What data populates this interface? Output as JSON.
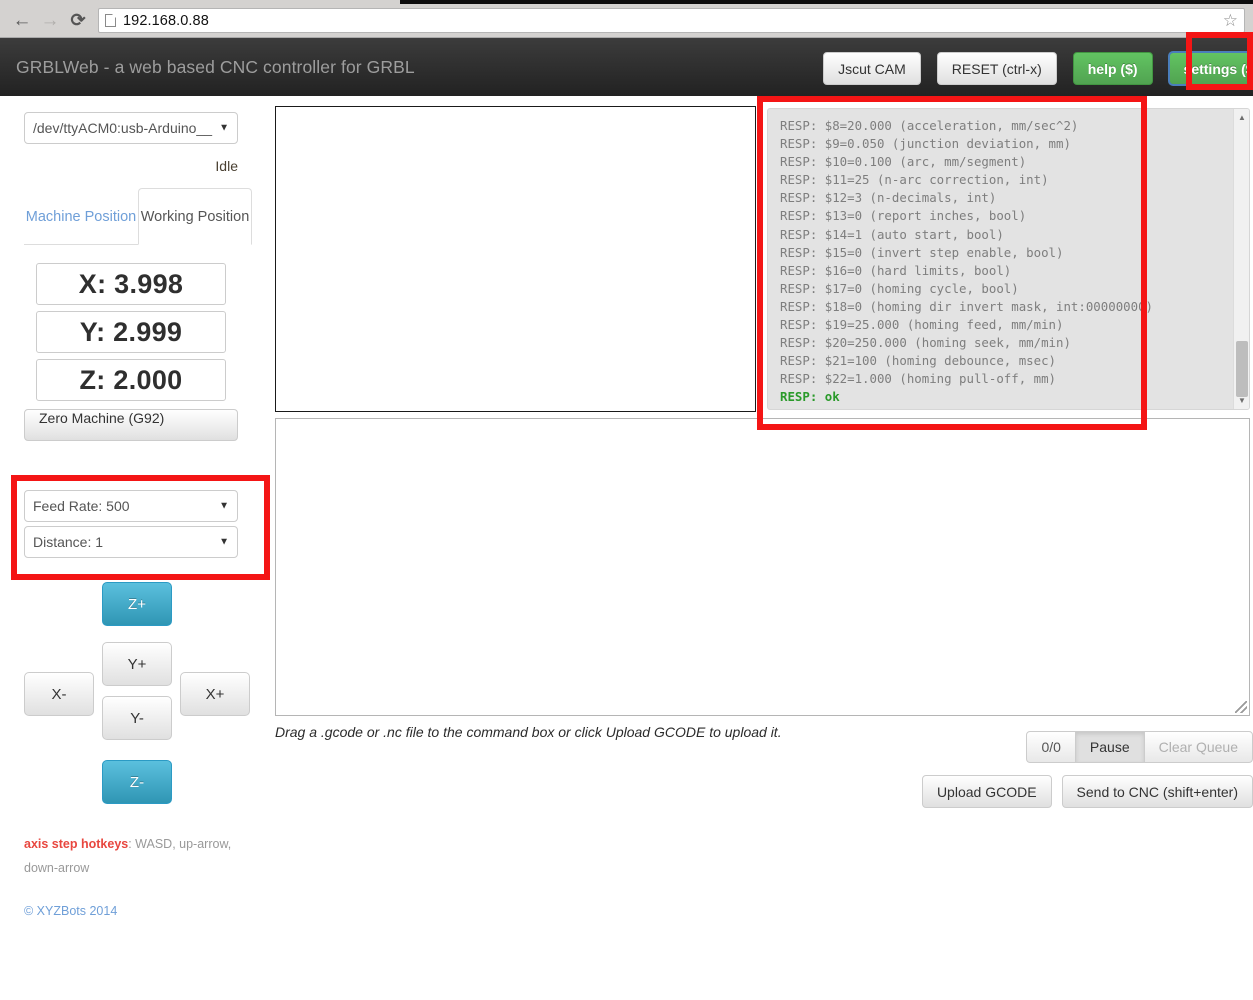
{
  "browser": {
    "url": "192.168.0.88",
    "back_icon": "back-arrow-icon",
    "forward_icon": "forward-arrow-icon",
    "reload_icon": "reload-icon",
    "page_icon": "page-icon",
    "star_icon": "star-icon"
  },
  "navbar": {
    "brand": "GRBLWeb - a web based CNC controller for GRBL",
    "buttons": [
      {
        "label": "Jscut CAM",
        "style": "default"
      },
      {
        "label": "RESET (ctrl-x)",
        "style": "default"
      },
      {
        "label": "help ($)",
        "style": "success"
      },
      {
        "label": "settings ($$)",
        "style": "success"
      }
    ]
  },
  "sidebar": {
    "port_select": "/dev/ttyACM0:usb-Arduino__",
    "status": "Idle",
    "tabs": [
      {
        "label": "Machine Position",
        "active": false
      },
      {
        "label": "Working Position",
        "active": true
      }
    ],
    "coords": [
      {
        "axis": "X",
        "text": "X: 3.998"
      },
      {
        "axis": "Y",
        "text": "Y: 2.999"
      },
      {
        "axis": "Z",
        "text": "Z: 2.000"
      }
    ],
    "zero_button": "Zero Machine (G92)",
    "feed_rate": "Feed Rate: 500",
    "distance": "Distance: 1",
    "jog": {
      "z_plus": "Z+",
      "y_plus": "Y+",
      "x_minus": "X-",
      "x_plus": "X+",
      "y_minus": "Y-",
      "z_minus": "Z-"
    },
    "hotkeys_label": "axis step hotkeys",
    "hotkeys_value": ": WASD, up-arrow, down-arrow",
    "copyright": "© XYZBots 2014"
  },
  "console": {
    "lines": "RESP: $8=20.000 (acceleration, mm/sec^2)\nRESP: $9=0.050 (junction deviation, mm)\nRESP: $10=0.100 (arc, mm/segment)\nRESP: $11=25 (n-arc correction, int)\nRESP: $12=3 (n-decimals, int)\nRESP: $13=0 (report inches, bool)\nRESP: $14=1 (auto start, bool)\nRESP: $15=0 (invert step enable, bool)\nRESP: $16=0 (hard limits, bool)\nRESP: $17=0 (homing cycle, bool)\nRESP: $18=0 (homing dir invert mask, int:00000000)\nRESP: $19=25.000 (homing feed, mm/min)\nRESP: $20=250.000 (homing seek, mm/min)\nRESP: $21=100 (homing debounce, msec)\nRESP: $22=1.000 (homing pull-off, mm)\n",
    "ok_line": "RESP: ok"
  },
  "main": {
    "command_placeholder": "",
    "drag_hint": "Drag a .gcode or .nc file to the command box or click Upload GCODE to upload it.",
    "queue": [
      {
        "label": "0/0",
        "state": "normal"
      },
      {
        "label": "Pause",
        "state": "pressed"
      },
      {
        "label": "Clear Queue",
        "state": "muted"
      }
    ],
    "actions": [
      {
        "label": "Upload GCODE"
      },
      {
        "label": "Send to CNC (shift+enter)"
      }
    ]
  },
  "colors": {
    "highlight": "#f41515",
    "success": "#51a351",
    "info": "#2f96b4",
    "link": "#6f9fd8",
    "console_ok": "#2a9a2a"
  }
}
